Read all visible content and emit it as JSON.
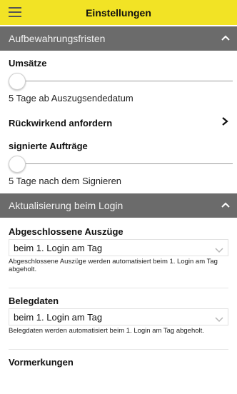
{
  "header": {
    "title": "Einstellungen",
    "menu_icon": "hamburger-icon"
  },
  "sections": {
    "retention": {
      "title": "Aufbewahrungsfristen",
      "turnover_label": "Umsätze",
      "turnover_slider_level": 0,
      "turnover_value": "5 Tage ab Auszugsendedatum",
      "request_retro_label": "Rückwirkend anfordern",
      "signed_orders_label": "signierte Aufträge",
      "signed_slider_level": 0,
      "signed_value": "5 Tage nach dem Signieren"
    },
    "login_update": {
      "title": "Aktualisierung beim Login",
      "statements_label": "Abgeschlossene Auszüge",
      "statements_select": "beim 1. Login am Tag",
      "statements_hint": "Abgeschlossene Auszüge werden automatisiert beim 1. Login am Tag abgeholt.",
      "receipts_label": "Belegdaten",
      "receipts_select": "beim 1. Login am Tag",
      "receipts_hint": "Belegdaten werden automatisiert beim 1. Login am Tag abgeholt.",
      "pending_label": "Vormerkungen"
    }
  },
  "colors": {
    "header_bg": "#f2e325",
    "section_bg": "#6b6b6b"
  }
}
